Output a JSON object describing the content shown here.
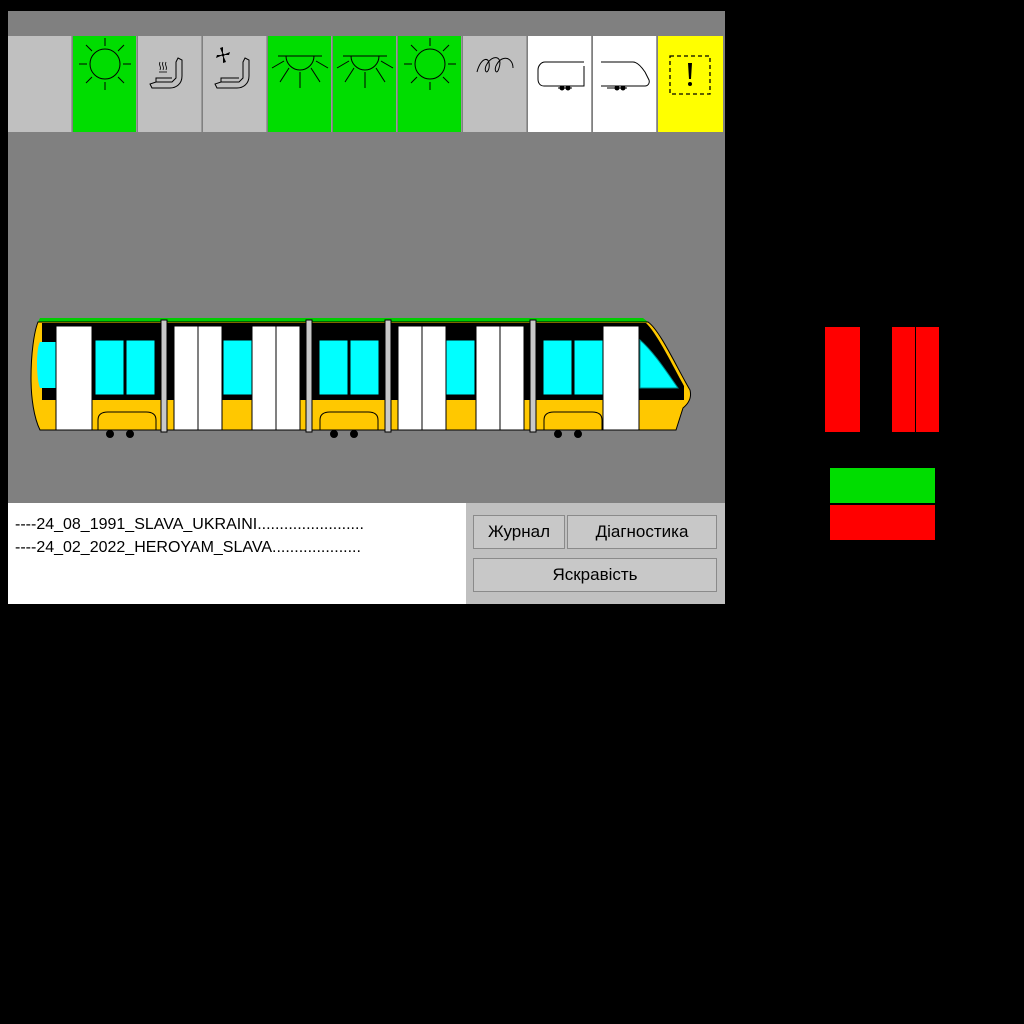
{
  "colors": {
    "active": "#00dd00",
    "inactive": "#c0c0c0",
    "neutral": "#ffffff",
    "warning": "#ffff00",
    "alarm": "#ff0000",
    "ok": "#00dd00",
    "train_body": "#ffc800",
    "train_window": "#00ffff",
    "background": "#808080"
  },
  "status_icons": [
    {
      "icon": "blank-tile",
      "state": "inactive"
    },
    {
      "icon": "sun-icon",
      "state": "active"
    },
    {
      "icon": "heated-seat-icon",
      "state": "inactive"
    },
    {
      "icon": "ventilated-seat-icon",
      "state": "inactive"
    },
    {
      "icon": "ceiling-light-icon",
      "state": "active"
    },
    {
      "icon": "ceiling-light-icon",
      "state": "active"
    },
    {
      "icon": "sun-icon",
      "state": "active"
    },
    {
      "icon": "coil-spring-icon",
      "state": "inactive"
    },
    {
      "icon": "tram-rear-cab-icon",
      "state": "neutral"
    },
    {
      "icon": "tram-front-cab-icon",
      "state": "neutral"
    },
    {
      "icon": "warning-exclamation-icon",
      "state": "warning"
    }
  ],
  "log": {
    "lines": [
      "----24_08_1991_SLAVA_UKRAINI........................",
      "----24_02_2022_HEROYAM_SLAVA...................."
    ]
  },
  "buttons": {
    "journal": "Журнал",
    "diagnostics": "Діагностика",
    "brightness": "Яскравість"
  },
  "indicators": {
    "left_block": "alarm",
    "right_block": "alarm",
    "upper_bar": "ok",
    "lower_bar": "alarm"
  }
}
